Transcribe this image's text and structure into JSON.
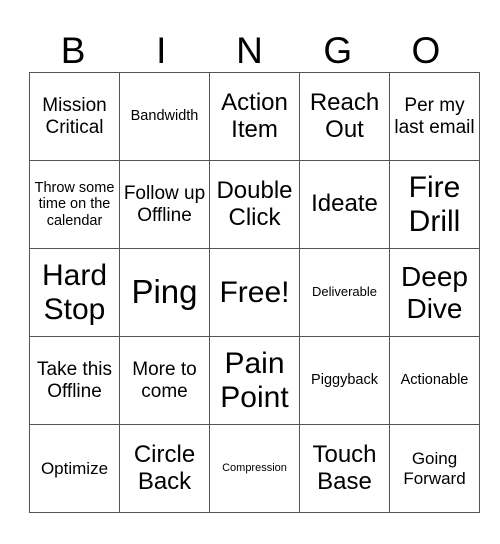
{
  "header": [
    "B",
    "I",
    "N",
    "G",
    "O"
  ],
  "rows": [
    [
      "Mission Critical",
      "Bandwidth",
      "Action Item",
      "Reach Out",
      "Per my last email"
    ],
    [
      "Throw some time on the calendar",
      "Follow up Offline",
      "Double Click",
      "Ideate",
      "Fire Drill"
    ],
    [
      "Hard Stop",
      "Ping",
      "Free!",
      "Deliverable",
      "Deep Dive"
    ],
    [
      "Take this Offline",
      "More to come",
      "Pain Point",
      "Piggyback",
      "Actionable"
    ],
    [
      "Optimize",
      "Circle Back",
      "Compression",
      "Touch Base",
      "Going Forward"
    ]
  ]
}
